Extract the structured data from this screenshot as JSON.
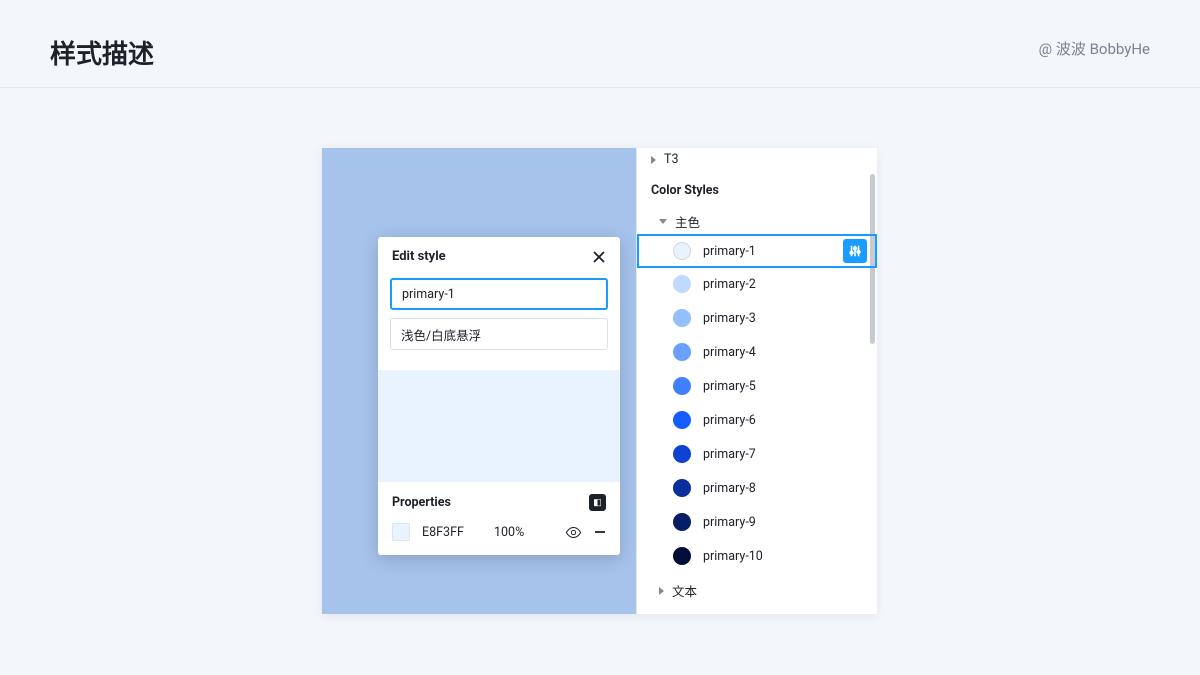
{
  "header": {
    "title": "样式描述",
    "attribution": "@ 波波 BobbyHe"
  },
  "editPopup": {
    "title": "Edit style",
    "nameValue": "primary-1",
    "descValue": "浅色/白底悬浮",
    "propertiesTitle": "Properties",
    "hex": "E8F3FF",
    "opacity": "100%"
  },
  "sidePanel": {
    "truncatedTop": "T3",
    "sectionTitle": "Color Styles",
    "groupLabel": "主色",
    "colors": [
      {
        "label": "primary-1",
        "hex": "#E8F3FF",
        "outline": true,
        "selected": true
      },
      {
        "label": "primary-2",
        "hex": "#BEDAFF",
        "outline": false,
        "selected": false
      },
      {
        "label": "primary-3",
        "hex": "#94BFFF",
        "outline": false,
        "selected": false
      },
      {
        "label": "primary-4",
        "hex": "#6AA1FF",
        "outline": false,
        "selected": false
      },
      {
        "label": "primary-5",
        "hex": "#4080FF",
        "outline": false,
        "selected": false
      },
      {
        "label": "primary-6",
        "hex": "#165DFF",
        "outline": false,
        "selected": false
      },
      {
        "label": "primary-7",
        "hex": "#0E42D2",
        "outline": false,
        "selected": false
      },
      {
        "label": "primary-8",
        "hex": "#0A2E9C",
        "outline": false,
        "selected": false
      },
      {
        "label": "primary-9",
        "hex": "#061D67",
        "outline": false,
        "selected": false
      },
      {
        "label": "primary-10",
        "hex": "#030E38",
        "outline": false,
        "selected": false
      }
    ],
    "nextGroup": "文本"
  }
}
